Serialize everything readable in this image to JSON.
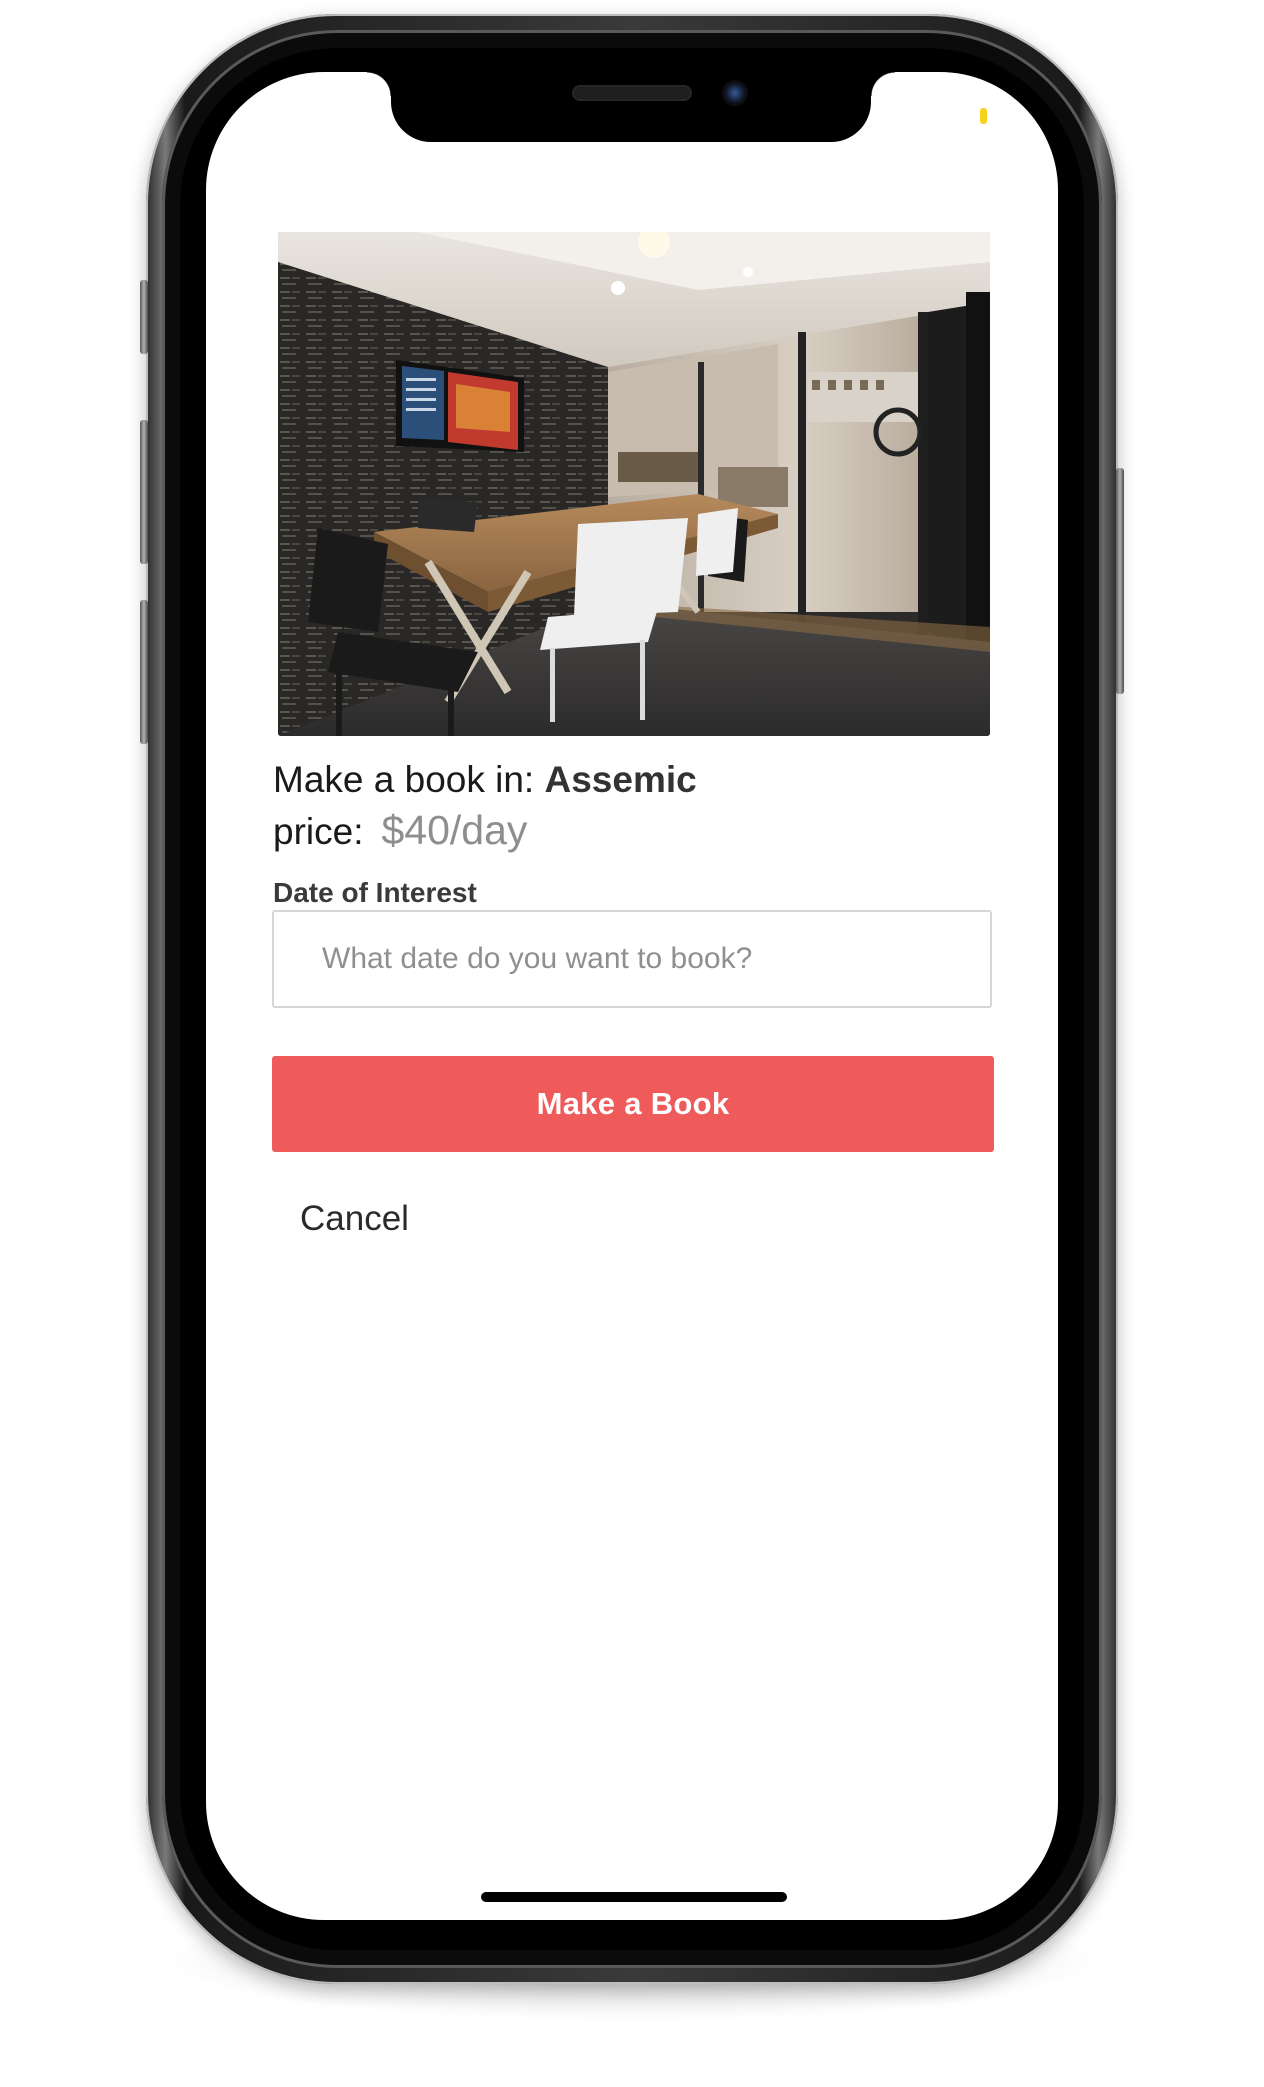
{
  "booking": {
    "prefix": "Make a book in:",
    "venue_name": "Assemic",
    "price_label": "price:",
    "price_value": "$40/day",
    "photo_icon": "meeting-room-photo"
  },
  "form": {
    "date_label": "Date of Interest",
    "date_placeholder": "What date do you want to book?",
    "date_value": ""
  },
  "actions": {
    "submit_label": "Make a Book",
    "cancel_label": "Cancel"
  },
  "colors": {
    "accent": "#ef5b5b",
    "price_text": "#8e8e8e",
    "status_indicator": "#f7d21a"
  }
}
